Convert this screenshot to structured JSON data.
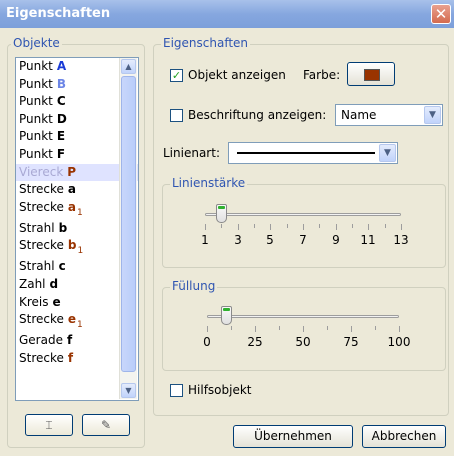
{
  "window": {
    "title": "Eigenschaften",
    "close_glyph": "✕"
  },
  "objects_panel": {
    "group_label": "Objekte",
    "items": [
      {
        "type": "Punkt",
        "name": "A",
        "name_color": "#1a3bd6",
        "subscript": ""
      },
      {
        "type": "Punkt",
        "name": "B",
        "name_color": "#6d86e6",
        "subscript": ""
      },
      {
        "type": "Punkt",
        "name": "C",
        "name_color": "#000000",
        "subscript": ""
      },
      {
        "type": "Punkt",
        "name": "D",
        "name_color": "#000000",
        "subscript": ""
      },
      {
        "type": "Punkt",
        "name": "E",
        "name_color": "#000000",
        "subscript": ""
      },
      {
        "type": "Punkt",
        "name": "F",
        "name_color": "#000000",
        "subscript": ""
      },
      {
        "type": "Viereck",
        "name": "P",
        "name_color": "#993300",
        "subscript": "",
        "selected": true
      },
      {
        "type": "Strecke",
        "name": "a",
        "name_color": "#000000",
        "subscript": ""
      },
      {
        "type": "Strecke",
        "name": "a",
        "name_color": "#993300",
        "subscript": "1"
      },
      {
        "type": "Strahl",
        "name": "b",
        "name_color": "#000000",
        "subscript": ""
      },
      {
        "type": "Strecke",
        "name": "b",
        "name_color": "#993300",
        "subscript": "1"
      },
      {
        "type": "Strahl",
        "name": "c",
        "name_color": "#000000",
        "subscript": ""
      },
      {
        "type": "Zahl",
        "name": "d",
        "name_color": "#000000",
        "subscript": ""
      },
      {
        "type": "Kreis",
        "name": "e",
        "name_color": "#000000",
        "subscript": ""
      },
      {
        "type": "Strecke",
        "name": "e",
        "name_color": "#993300",
        "subscript": "1"
      },
      {
        "type": "Gerade",
        "name": "f",
        "name_color": "#000000",
        "subscript": ""
      },
      {
        "type": "Strecke",
        "name": "f",
        "name_color": "#993300",
        "subscript": ""
      }
    ],
    "scroll_up_glyph": "▲",
    "scroll_down_glyph": "▼",
    "buttons": [
      {
        "icon": "rename-icon",
        "glyph": "⌶"
      },
      {
        "icon": "eraser-icon",
        "glyph": "✎"
      }
    ]
  },
  "properties": {
    "group_label": "Eigenschaften",
    "show_object": {
      "label": "Objekt anzeigen",
      "checked": true,
      "check_glyph": "✓"
    },
    "color": {
      "label": "Farbe:",
      "value": "#993300"
    },
    "show_label": {
      "label": "Beschriftung anzeigen:",
      "checked": false
    },
    "label_mode": {
      "selected": "Name"
    },
    "line_style": {
      "label": "Linienart:"
    },
    "line_width": {
      "label": "Linienstärke",
      "min": 1,
      "max": 13,
      "value": 2,
      "tick_labels": [
        "1",
        "3",
        "5",
        "7",
        "9",
        "11",
        "13"
      ]
    },
    "fill": {
      "label": "Füllung",
      "min": 0,
      "max": 100,
      "value": 10,
      "tick_labels": [
        "0",
        "25",
        "50",
        "75",
        "100"
      ]
    },
    "aux_object": {
      "label": "Hilfsobjekt",
      "checked": false
    }
  },
  "footer": {
    "apply_label": "Übernehmen",
    "cancel_label": "Abbrechen"
  }
}
